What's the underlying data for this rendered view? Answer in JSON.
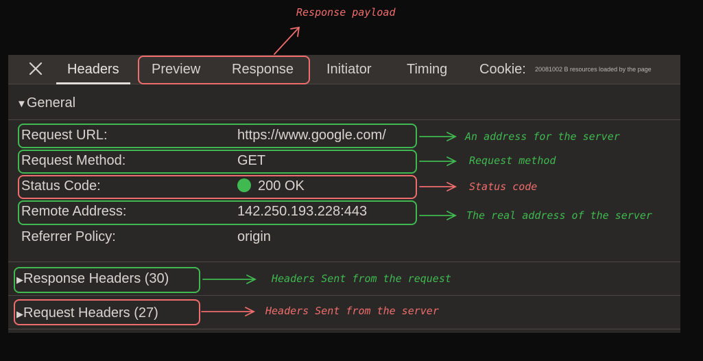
{
  "tabs": [
    "Headers",
    "Preview",
    "Response",
    "Initiator",
    "Timing",
    "Cookie:"
  ],
  "resources_note": "20081002 B resources loaded by the page",
  "general": {
    "header": "General",
    "rows": [
      {
        "label": "Request URL:",
        "value": "https://www.google.com/"
      },
      {
        "label": "Request Method:",
        "value": "GET"
      },
      {
        "label": "Status Code:",
        "value": "200 OK"
      },
      {
        "label": "Remote Address:",
        "value": "142.250.193.228:443"
      },
      {
        "label": "Referrer Policy:",
        "value": "origin"
      }
    ]
  },
  "response_headers": "Response Headers (30)",
  "request_headers": "Request Headers (27)",
  "annotations": {
    "payload": "Response payload",
    "url": "An address for the server",
    "method": "Request method",
    "status": "Status code",
    "remote": "The real address of the server",
    "resp_headers": "Headers Sent from the request",
    "req_headers": "Headers Sent from the server"
  },
  "colors": {
    "annotation_red": "#f06d6d",
    "annotation_green": "#3fb950",
    "status_ok": "#3fb950"
  },
  "icons": {
    "close": "close-icon",
    "expand": "triangle-down-icon",
    "collapsed": "triangle-right-icon"
  }
}
